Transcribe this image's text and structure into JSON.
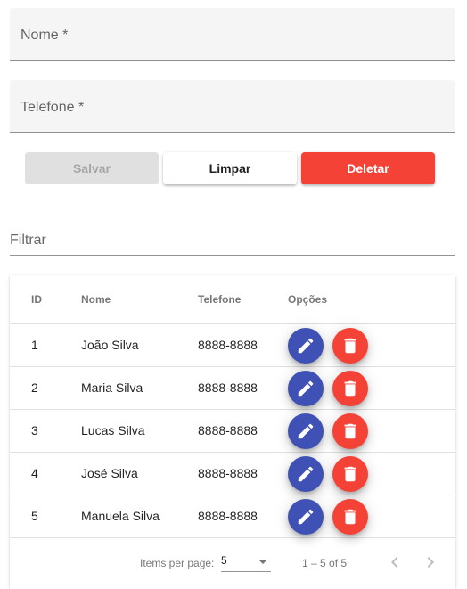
{
  "form": {
    "nome_label": "Nome *",
    "telefone_label": "Telefone *"
  },
  "actions": {
    "save_label": "Salvar",
    "clear_label": "Limpar",
    "delete_label": "Deletar"
  },
  "filter": {
    "label": "Filtrar"
  },
  "table": {
    "headers": {
      "id": "ID",
      "nome": "Nome",
      "telefone": "Telefone",
      "opcoes": "Opções"
    },
    "rows": [
      {
        "id": "1",
        "nome": "João Silva",
        "telefone": "8888-8888"
      },
      {
        "id": "2",
        "nome": "Maria Silva",
        "telefone": "8888-8888"
      },
      {
        "id": "3",
        "nome": "Lucas Silva",
        "telefone": "8888-8888"
      },
      {
        "id": "4",
        "nome": "José Silva",
        "telefone": "8888-8888"
      },
      {
        "id": "5",
        "nome": "Manuela Silva",
        "telefone": "8888-8888"
      }
    ],
    "row_icons": {
      "edit": "pencil-icon",
      "delete": "trash-icon"
    }
  },
  "paginator": {
    "items_per_page_label": "Items per page:",
    "page_size": "5",
    "range_label": "1 – 5 of 5"
  },
  "colors": {
    "primary": "#3f51b5",
    "warn": "#f44336",
    "disabled_bg": "#e0e0e0"
  }
}
